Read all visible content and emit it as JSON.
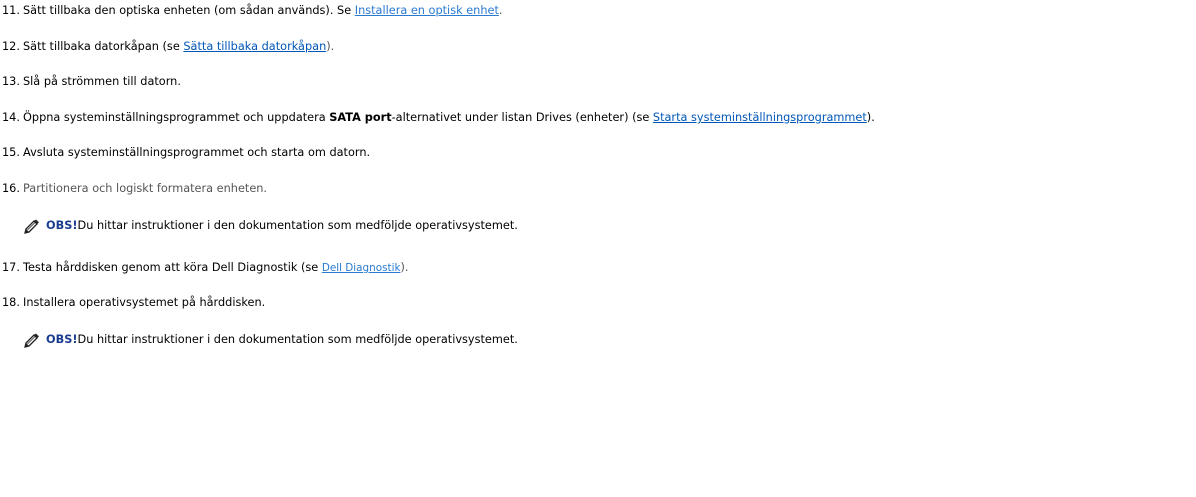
{
  "steps": [
    {
      "num": "11.",
      "pre": "Sätt tillbaka den optiska enheten (om sådan används). Se ",
      "link": "Installera en optisk enhet",
      "post": "."
    },
    {
      "num": "12.",
      "pre": "Sätt tillbaka datorkåpan (se ",
      "link": "Sätta tillbaka datorkåpan",
      "post": ")."
    },
    {
      "num": "13.",
      "text": "Slå på strömmen till datorn."
    },
    {
      "num": "14.",
      "pre": "Öppna systeminställningsprogrammet och uppdatera ",
      "bold": "SATA port",
      "mid": "-alternativet under listan Drives (enheter) (se ",
      "link": "Starta systeminställningsprogrammet",
      "post": ")."
    },
    {
      "num": "15.",
      "text": "Avsluta systeminställningsprogrammet och starta om datorn."
    },
    {
      "num": "16.",
      "text": "Partitionera och logiskt formatera enheten."
    },
    {
      "num": "17.",
      "pre": "Testa hårddisken genom att köra Dell Diagnostik (se ",
      "link": "Dell Diagnostik",
      "post": ")."
    },
    {
      "num": "18.",
      "text": "Installera operativsystemet på hårddisken."
    }
  ],
  "notes": [
    {
      "label": "OBS!",
      "text": " Du hittar instruktioner i den dokumentation som medföljde operativsystemet."
    },
    {
      "label": "OBS!",
      "text": " Du hittar instruktioner i den dokumentation som medföljde operativsystemet."
    }
  ]
}
